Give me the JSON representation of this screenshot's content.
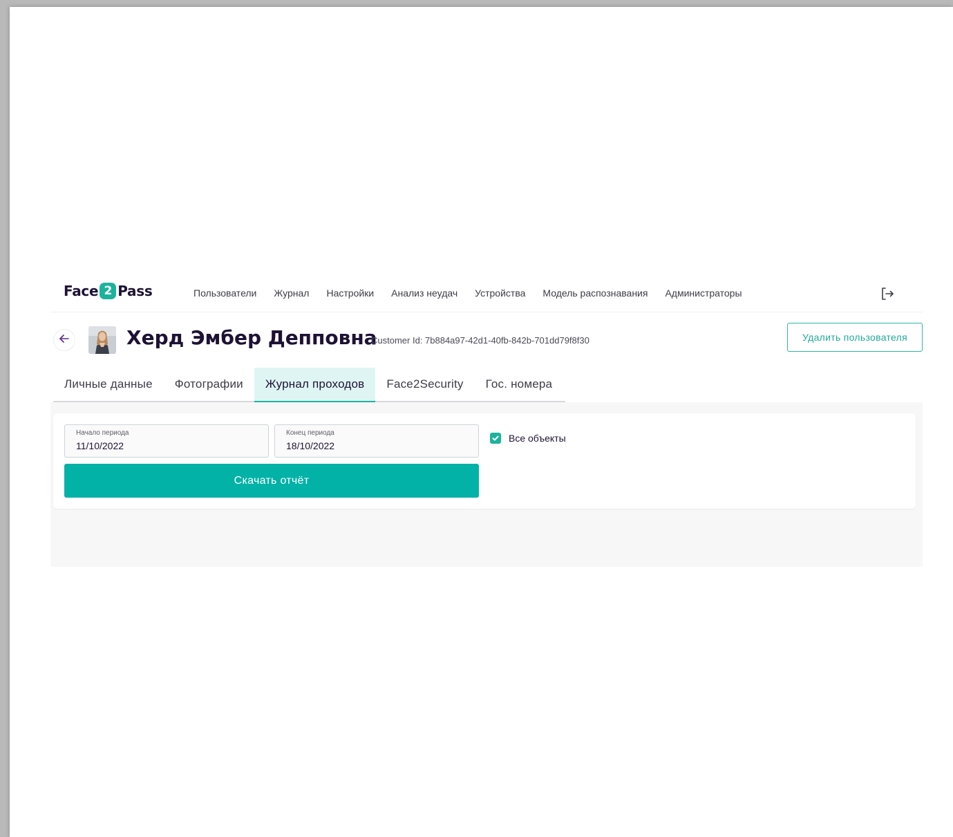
{
  "colors": {
    "accent": "#1cb39c",
    "button": "#03b2a7",
    "text_dark": "#1d1235",
    "tab_active_bg": "#dff5f3"
  },
  "header": {
    "logo_left": "Face",
    "logo_mid": "2",
    "logo_right": "Pass",
    "nav": [
      "Пользователи",
      "Журнал",
      "Настройки",
      "Анализ неудач",
      "Устройства",
      "Модель распознавания",
      "Администраторы"
    ],
    "logout_icon": "logout-icon"
  },
  "profile": {
    "name": "Херд Эмбер Депповна",
    "customer_id": "Customer Id: 7b884a97-42d1-40fb-842b-701dd79f8f30",
    "delete_label": "Удалить пользователя",
    "back_icon": "arrow-left-icon"
  },
  "tabs": [
    {
      "label": "Личные данные",
      "active": false
    },
    {
      "label": "Фотографии",
      "active": false
    },
    {
      "label": "Журнал проходов",
      "active": true
    },
    {
      "label": "Face2Security",
      "active": false
    },
    {
      "label": "Гос. номера",
      "active": false
    }
  ],
  "report": {
    "start_label": "Начало периода",
    "start_value": "11/10/2022",
    "end_label": "Конец периода",
    "end_value": "18/10/2022",
    "all_objects_label": "Все объекты",
    "all_objects_checked": true,
    "download_label": "Скачать отчёт"
  }
}
